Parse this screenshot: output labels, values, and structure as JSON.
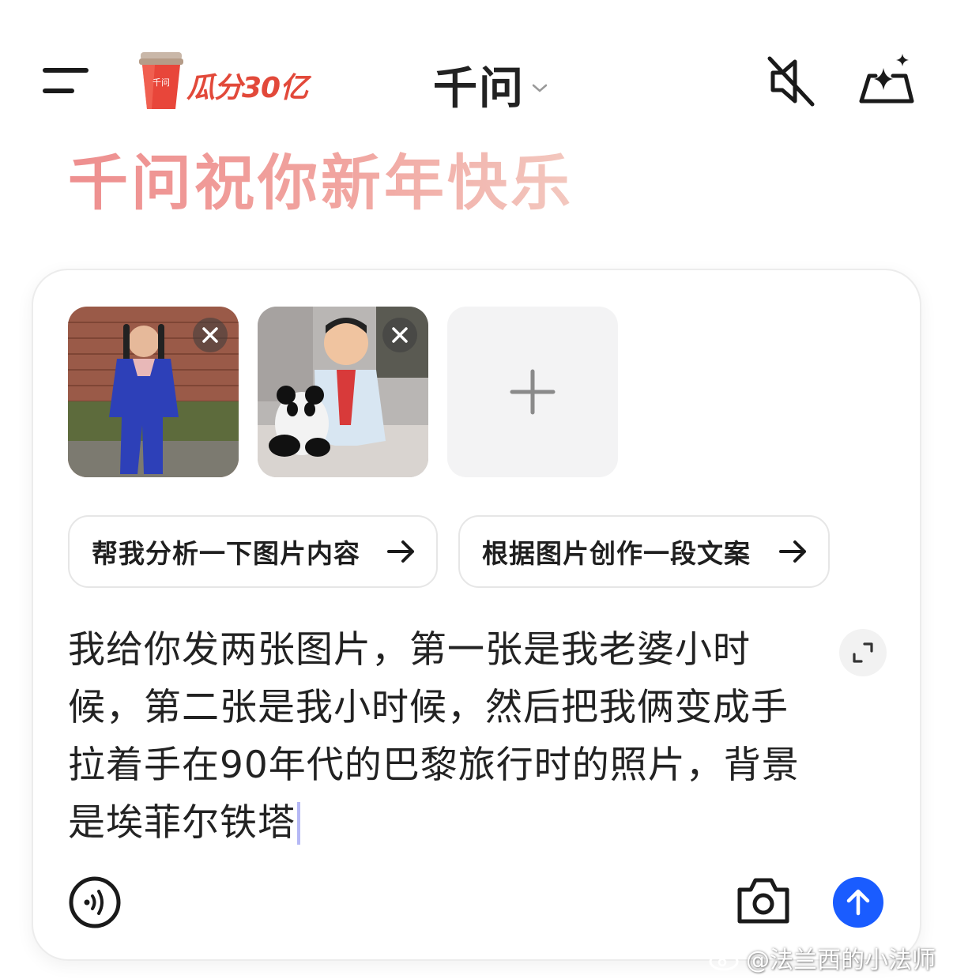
{
  "header": {
    "promo_text": "瓜分30亿",
    "promo_cup_label": "千问",
    "title": "千问"
  },
  "greeting": "千问祝你新年快乐",
  "attachments": [
    {
      "icon": "close-icon"
    },
    {
      "icon": "close-icon"
    }
  ],
  "suggestions": [
    {
      "label": "帮我分析一下图片内容",
      "icon": "arrow-right-icon"
    },
    {
      "label": "根据图片创作一段文案",
      "icon": "arrow-right-icon"
    }
  ],
  "input": {
    "text": "我给你发两张图片，第一张是我老婆小时候，第二张是我小时候，然后把我俩变成手拉着手在90年代的巴黎旅行时的照片，背景是埃菲尔铁塔"
  },
  "watermark": "@法兰西的小法师",
  "colors": {
    "accent": "#1a5cff",
    "greeting_gradient_start": "#ee8f8f",
    "greeting_gradient_end": "#f3c8bf",
    "promo": "#e2493a"
  }
}
